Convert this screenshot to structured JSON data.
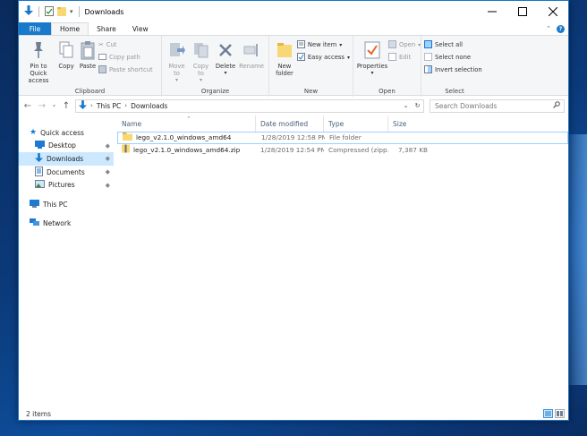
{
  "window": {
    "title": "Downloads"
  },
  "ribbon": {
    "tabs": [
      {
        "label": "File"
      },
      {
        "label": "Home"
      },
      {
        "label": "Share"
      },
      {
        "label": "View"
      }
    ],
    "clipboard": {
      "label": "Clipboard",
      "pin_to_quick_access": "Pin to Quick access",
      "copy": "Copy",
      "paste": "Paste",
      "cut": "Cut",
      "copy_path": "Copy path",
      "paste_shortcut": "Paste shortcut"
    },
    "organize": {
      "label": "Organize",
      "move_to": "Move to",
      "copy_to": "Copy to",
      "delete": "Delete",
      "rename": "Rename"
    },
    "new": {
      "label": "New",
      "new_folder": "New folder",
      "new_item": "New item",
      "easy_access": "Easy access"
    },
    "open": {
      "label": "Open",
      "properties": "Properties",
      "open": "Open",
      "edit": "Edit"
    },
    "select": {
      "label": "Select",
      "select_all": "Select all",
      "select_none": "Select none",
      "invert_selection": "Invert selection"
    }
  },
  "address": {
    "crumbs": [
      "This PC",
      "Downloads"
    ],
    "search_placeholder": "Search Downloads"
  },
  "navigation": {
    "items": [
      {
        "label": "Quick access"
      },
      {
        "label": "Desktop"
      },
      {
        "label": "Downloads"
      },
      {
        "label": "Documents"
      },
      {
        "label": "Pictures"
      },
      {
        "label": "This PC"
      },
      {
        "label": "Network"
      }
    ]
  },
  "file_list": {
    "columns": [
      "Name",
      "Date modified",
      "Type",
      "Size"
    ],
    "rows": [
      {
        "name": "lego_v2.1.0_windows_amd64",
        "date": "1/28/2019 12:58 PM",
        "type": "File folder",
        "size": ""
      },
      {
        "name": "lego_v2.1.0_windows_amd64.zip",
        "date": "1/28/2019 12:54 PM",
        "type": "Compressed (zipp...",
        "size": "7,387 KB"
      }
    ]
  },
  "status": {
    "item_count": "2 items"
  },
  "colors": {
    "accent": "#1979ca",
    "selection": "#cce8ff",
    "folder": "#f8d775"
  }
}
